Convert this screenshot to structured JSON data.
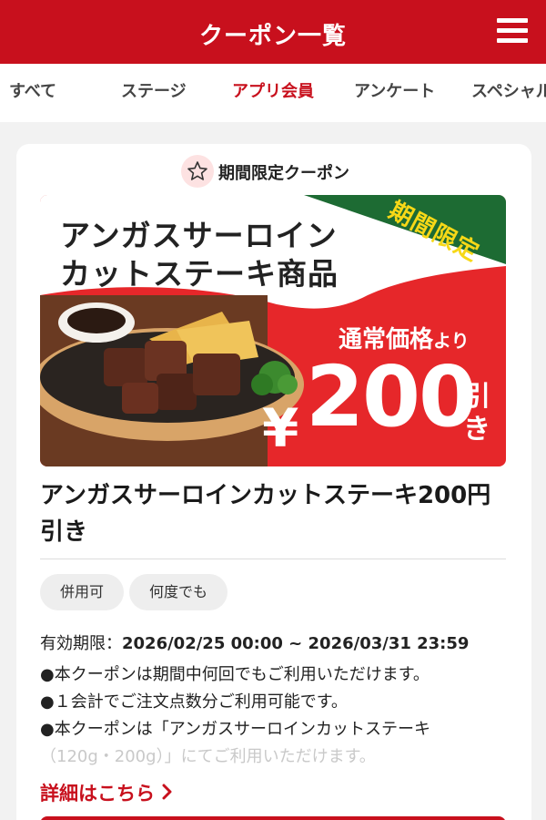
{
  "header": {
    "title": "クーポン一覧",
    "menu_icon": "hamburger-menu-icon"
  },
  "tabs": [
    {
      "label": "すべて"
    },
    {
      "label": "ステージ"
    },
    {
      "label": "アプリ会員"
    },
    {
      "label": "アンケート"
    },
    {
      "label": "スペシャル"
    }
  ],
  "selected_tab": "アプリ会員",
  "coupon": {
    "badge_label": "期間限定クーポン",
    "badge_icon": "star-icon",
    "banner": {
      "title_line1": "アンガスサーロイン",
      "title_line2": "カットステーキ商品",
      "ribbon": "期間限定",
      "price_lead": "通常価格",
      "price_lead_small": "より",
      "currency": "¥",
      "amount": "200",
      "suffix": "引き"
    },
    "title": "アンガスサーロインカットステーキ200円引き",
    "tags": [
      "併用可",
      "何度でも"
    ],
    "validity_label": "有効期限：",
    "validity_value": "2026/02/25 00:00 ~ 2026/03/31 23:59",
    "notes": [
      "●本クーポンは期間中何回でもご利用いただけます。",
      "●１会計でご注文点数分ご利用可能です。",
      "●本クーポンは「アンガスサーロインカットステーキ",
      "（120g・200g）」にてご利用いただけます。"
    ],
    "detail_link": "詳細はこちら",
    "detail_icon": "chevron-right-icon"
  },
  "colors": {
    "brand_red": "#c8101d",
    "banner_red": "#e6272a",
    "ribbon_green": "#1d6b33",
    "ribbon_yellow": "#f7d817"
  }
}
